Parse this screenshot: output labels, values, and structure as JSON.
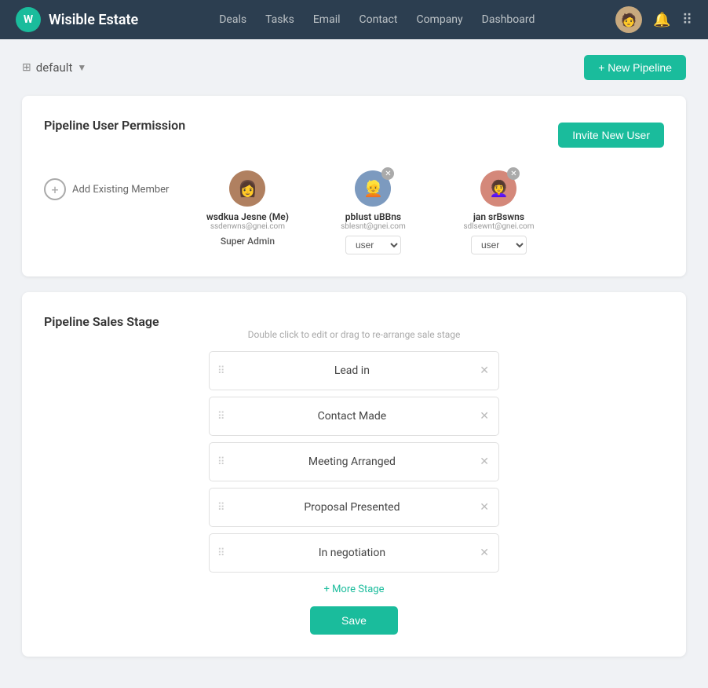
{
  "app": {
    "brand_icon": "W",
    "brand_name": "Wisible Estate"
  },
  "nav": {
    "links": [
      "Deals",
      "Tasks",
      "Email",
      "Contact",
      "Company",
      "Dashboard"
    ]
  },
  "top_bar": {
    "pipeline_label": "default",
    "new_pipeline_btn": "+ New Pipeline"
  },
  "permission_card": {
    "title": "Pipeline User Permission",
    "invite_btn": "Invite New User",
    "add_member_label": "Add Existing Member",
    "members": [
      {
        "name": "wsdkua Jesne (Me)",
        "email": "ssdenwns@gnei.com",
        "role": "Super Admin",
        "avatar_class": "av1",
        "has_close": false
      },
      {
        "name": "pblust uBBns",
        "email": "sblesnt@gnei.com",
        "role": "user",
        "avatar_class": "av2",
        "has_close": true
      },
      {
        "name": "jan srBswns",
        "email": "sdlsewnt@gnei.com",
        "role": "user",
        "avatar_class": "av3",
        "has_close": true
      }
    ]
  },
  "sales_stage_card": {
    "title": "Pipeline Sales Stage",
    "hint": "Double click to edit or drag to re-arrange sale stage",
    "stages": [
      "Lead in",
      "Contact Made",
      "Meeting Arranged",
      "Proposal Presented",
      "In negotiation"
    ],
    "more_stage_label": "+ More Stage",
    "save_btn": "Save"
  }
}
